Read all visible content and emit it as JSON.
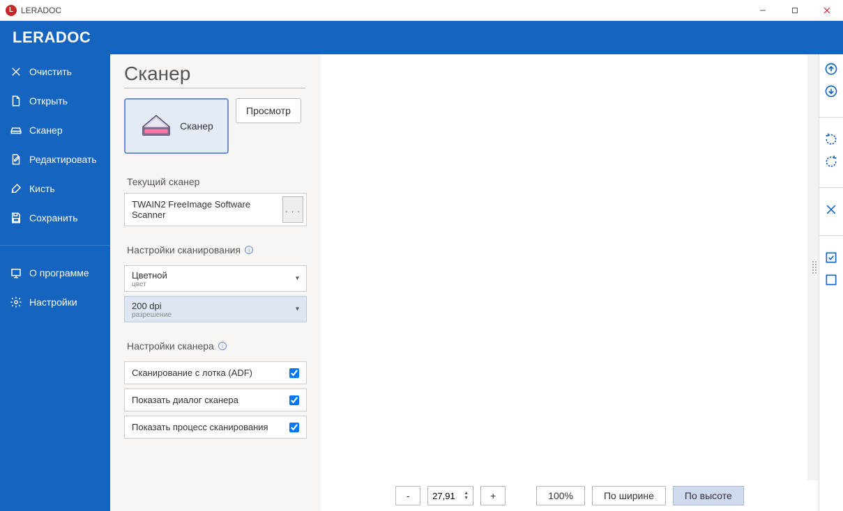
{
  "window": {
    "title": "LERADOC",
    "appIconLetter": "L"
  },
  "brand": "LERADOC",
  "sidebar": {
    "items": [
      {
        "label": "Очистить"
      },
      {
        "label": "Открыть"
      },
      {
        "label": "Сканер"
      },
      {
        "label": "Редактировать"
      },
      {
        "label": "Кисть"
      },
      {
        "label": "Сохранить"
      }
    ],
    "footerItems": [
      {
        "label": "О программе"
      },
      {
        "label": "Настройки"
      }
    ]
  },
  "panel": {
    "title": "Сканер",
    "scanButton": "Сканер",
    "previewButton": "Просмотр",
    "currentScannerHeader": "Текущий сканер",
    "currentScannerName": "TWAIN2 FreeImage Software Scanner",
    "browse": ". . .",
    "scanSettingsHeader": "Настройки сканирования",
    "colorMode": {
      "value": "Цветной",
      "sub": "цвет"
    },
    "resolution": {
      "value": "200 dpi",
      "sub": "разрешение"
    },
    "scannerSettingsHeader": "Настройки сканера",
    "checks": {
      "adf": "Сканирование с лотка (ADF)",
      "dialog": "Показать диалог сканера",
      "progress": "Показать процесс сканирования"
    }
  },
  "toolbar": {
    "minus": "-",
    "zoomValue": "27,91",
    "plus": "+",
    "hundred": "100%",
    "byWidth": "По ширине",
    "byHeight": "По высоте"
  }
}
